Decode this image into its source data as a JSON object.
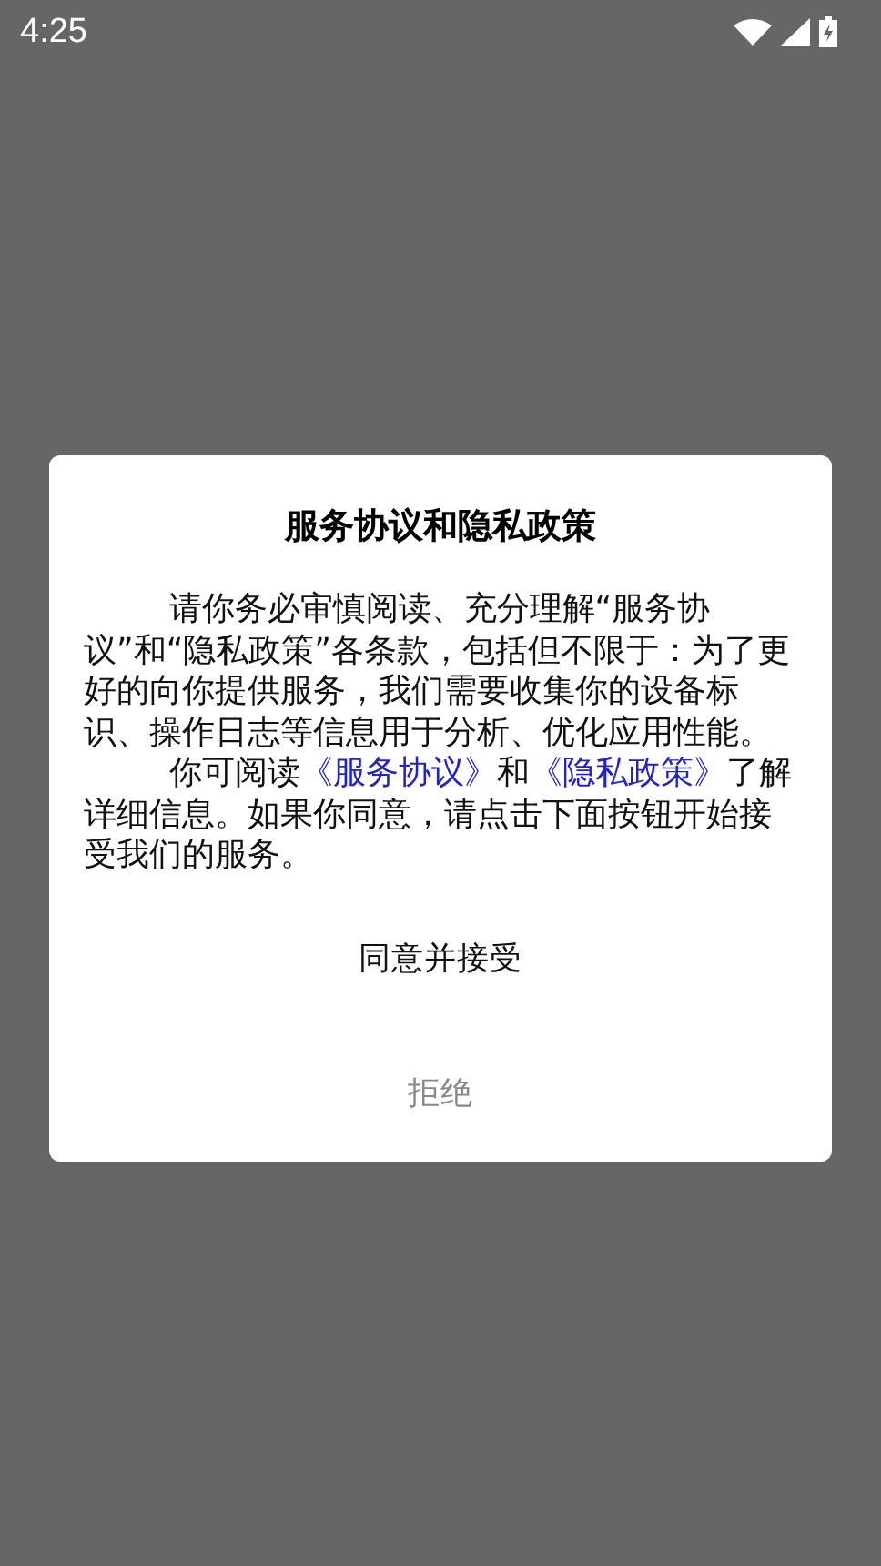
{
  "status_bar": {
    "time": "4:25"
  },
  "dialog": {
    "title": "服务协议和隐私政策",
    "paragraphs": [
      {
        "parts": [
          {
            "kind": "text",
            "text": "请你务必审慎阅读、充分理解“服务协议”和“隐私政策”各条款，包括但不限于：为了更好的向你提供服务，我们需要收集你的设备标识、操作日志等信息用于分析、优化应用性能。"
          }
        ]
      },
      {
        "parts": [
          {
            "kind": "text",
            "text": "你可阅读"
          },
          {
            "kind": "link",
            "text": "《服务协议》"
          },
          {
            "kind": "text",
            "text": "和"
          },
          {
            "kind": "link",
            "text": "《隐私政策》"
          },
          {
            "kind": "text",
            "text": "了解详细信息。如果你同意，请点击下面按钮开始接受我们的服务。"
          }
        ]
      }
    ],
    "buttons": [
      {
        "label": "同意并接受",
        "kind": "primary"
      },
      {
        "label": "拒绝",
        "kind": "secondary"
      }
    ]
  }
}
